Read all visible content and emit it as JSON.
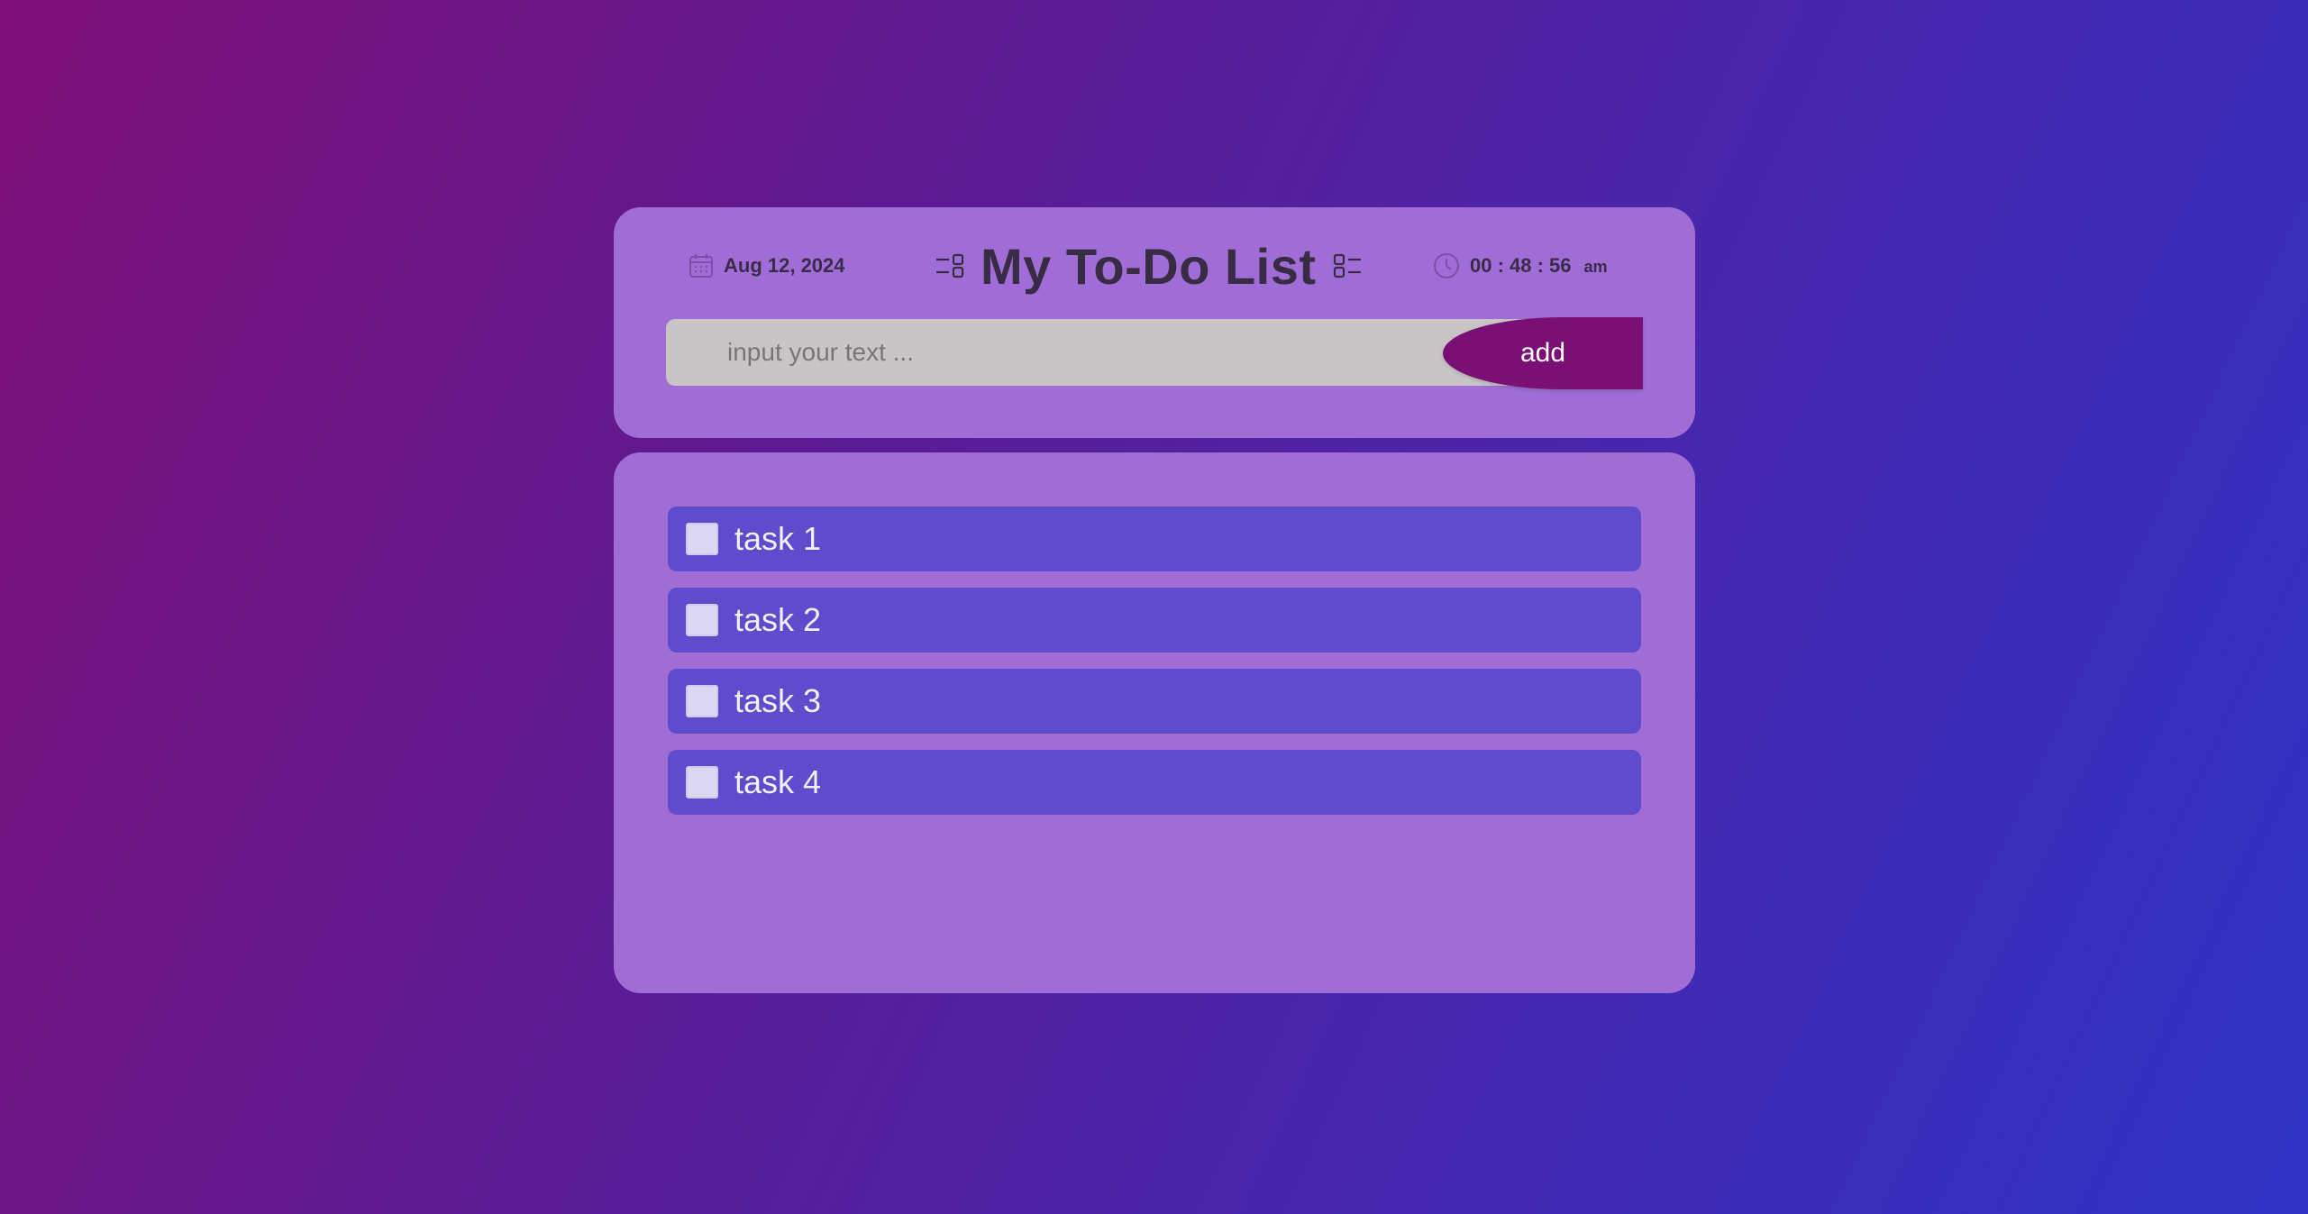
{
  "header": {
    "date": "Aug 12, 2024",
    "title": "My To-Do List",
    "time": "00 : 48 : 56",
    "ampm": "am",
    "icons": {
      "date": "calendar-icon",
      "title_left": "list-icon",
      "title_right": "checklist-icon",
      "time": "clock-icon"
    }
  },
  "input": {
    "placeholder": "input your text ...",
    "value": ""
  },
  "add_button": {
    "label": "add"
  },
  "tasks": [
    {
      "label": "task 1",
      "checked": false
    },
    {
      "label": "task 2",
      "checked": false
    },
    {
      "label": "task 3",
      "checked": false
    },
    {
      "label": "task 4",
      "checked": false
    }
  ],
  "colors": {
    "card": "#a06dd6",
    "task": "#5f4bcc",
    "accent": "#7a0f74",
    "input": "#c9c5c6",
    "text_dark": "#3a2b44"
  }
}
